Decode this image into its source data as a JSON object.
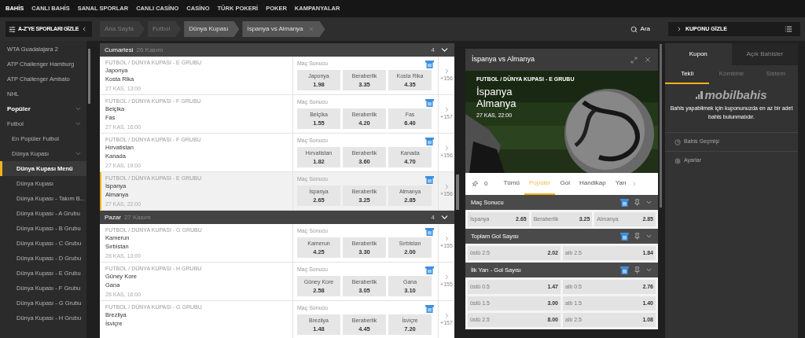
{
  "top_nav": [
    {
      "label": "BAHİS",
      "selected": true
    },
    {
      "label": "CANLI BAHİS",
      "selected": false
    },
    {
      "label": "SANAL SPORLAR",
      "selected": false
    },
    {
      "label": "CANLI CASİNO",
      "selected": false
    },
    {
      "label": "CASİNO",
      "selected": false
    },
    {
      "label": "TÜRK POKERİ",
      "selected": false
    },
    {
      "label": "POKER",
      "selected": false
    },
    {
      "label": "KAMPANYALAR",
      "selected": false
    }
  ],
  "toolbar": {
    "sports_toggle": "A-Z'YE SPORLARI GİZLE",
    "breadcrumbs": [
      {
        "label": "Ana Sayfa",
        "highlighted": false,
        "selected": false
      },
      {
        "label": "Futbol",
        "highlighted": false,
        "selected": false
      },
      {
        "label": "Dünya Kupası",
        "highlighted": true,
        "selected": false
      },
      {
        "label": "İspanya vs Almanya",
        "highlighted": true,
        "selected": true
      }
    ],
    "search": "Ara",
    "coupon_toggle": "KUPONU GİZLE"
  },
  "sidebar": {
    "items": [
      {
        "label": "WTA Guadalajara 2",
        "kind": "link",
        "selected": false
      },
      {
        "label": "ATP Challenger Hamburg",
        "kind": "link",
        "selected": false
      },
      {
        "label": "ATP Challenger Ambato",
        "kind": "link",
        "selected": false
      },
      {
        "label": "NHL",
        "kind": "link",
        "selected": false
      },
      {
        "label": "Popüler",
        "kind": "heading",
        "selected": false,
        "expanded": true,
        "children": [
          {
            "label": "Futbol",
            "kind": "link",
            "selected": false,
            "expanded": true,
            "children": [
              {
                "label": "En Popüler Futbol",
                "kind": "link",
                "selected": false
              },
              {
                "label": "Dünya Kupası",
                "kind": "link",
                "selected": false,
                "expanded": true,
                "children": [
                  {
                    "label": "Dünya Kupası Menü",
                    "kind": "link",
                    "selected": true
                  },
                  {
                    "label": "Dünya Kupası",
                    "kind": "link",
                    "selected": false
                  },
                  {
                    "label": "Dünya Kupası - Takım B...",
                    "kind": "link",
                    "selected": false
                  },
                  {
                    "label": "Dünya Kupası - A Grubu",
                    "kind": "link",
                    "selected": false
                  },
                  {
                    "label": "Dünya Kupası - B Grubu",
                    "kind": "link",
                    "selected": false
                  },
                  {
                    "label": "Dünya Kupası - C Grubu",
                    "kind": "link",
                    "selected": false
                  },
                  {
                    "label": "Dünya Kupası - D Grubu",
                    "kind": "link",
                    "selected": false
                  },
                  {
                    "label": "Dünya Kupası - E Grubu",
                    "kind": "link",
                    "selected": false
                  },
                  {
                    "label": "Dünya Kupası - F Grubu",
                    "kind": "link",
                    "selected": false
                  },
                  {
                    "label": "Dünya Kupası - G Grubu",
                    "kind": "link",
                    "selected": false
                  },
                  {
                    "label": "Dünya Kupası - H Grubu",
                    "kind": "link",
                    "selected": false
                  }
                ]
              }
            ]
          }
        ]
      }
    ]
  },
  "days": [
    {
      "day": "Cumartesi",
      "date": "26 Kasım",
      "count": "4",
      "expanded": true,
      "matches": [
        {
          "league": "FUTBOL / DÜNYA KUPASI - E GRUBU",
          "home": "Japonya",
          "away": "Kosta Rika",
          "time": "27 KAS, 13:00",
          "market": "Maç Sonucu",
          "odds": [
            {
              "label": "Japonya",
              "value": "1.98"
            },
            {
              "label": "Beraberlik",
              "value": "3.35"
            },
            {
              "label": "Kosta Rika",
              "value": "4.35"
            }
          ],
          "more": "+156",
          "selected": false
        },
        {
          "league": "FUTBOL / DÜNYA KUPASI - F GRUBU",
          "home": "Belçika",
          "away": "Fas",
          "time": "27 KAS, 16:00",
          "market": "Maç Sonucu",
          "odds": [
            {
              "label": "Belçika",
              "value": "1.55"
            },
            {
              "label": "Beraberlik",
              "value": "4.20"
            },
            {
              "label": "Fas",
              "value": "6.40"
            }
          ],
          "more": "+157",
          "selected": false
        },
        {
          "league": "FUTBOL / DÜNYA KUPASI - F GRUBU",
          "home": "Hırvatistan",
          "away": "Kanada",
          "time": "27 KAS, 19:00",
          "market": "Maç Sonucu",
          "odds": [
            {
              "label": "Hırvatistan",
              "value": "1.82"
            },
            {
              "label": "Beraberlik",
              "value": "3.60"
            },
            {
              "label": "Kanada",
              "value": "4.70"
            }
          ],
          "more": "+156",
          "selected": false
        },
        {
          "league": "FUTBOL / DÜNYA KUPASI - E GRUBU",
          "home": "İspanya",
          "away": "Almanya",
          "time": "27 KAS, 22:00",
          "market": "Maç Sonucu",
          "odds": [
            {
              "label": "İspanya",
              "value": "2.65"
            },
            {
              "label": "Beraberlik",
              "value": "3.25"
            },
            {
              "label": "Almanya",
              "value": "2.85"
            }
          ],
          "more": "+156",
          "selected": true
        }
      ]
    },
    {
      "day": "Pazar",
      "date": "27 Kasım",
      "count": "4",
      "expanded": true,
      "matches": [
        {
          "league": "FUTBOL / DÜNYA KUPASI - G GRUBU",
          "home": "Kamerun",
          "away": "Sırbistan",
          "time": "28 KAS, 13:00",
          "market": "Maç Sonucu",
          "odds": [
            {
              "label": "Kamerun",
              "value": "4.25"
            },
            {
              "label": "Beraberlik",
              "value": "3.30"
            },
            {
              "label": "Sırbistan",
              "value": "2.00"
            }
          ],
          "more": "+155",
          "selected": false
        },
        {
          "league": "FUTBOL / DÜNYA KUPASI - H GRUBU",
          "home": "Güney Kore",
          "away": "Gana",
          "time": "28 KAS, 16:00",
          "market": "Maç Sonucu",
          "odds": [
            {
              "label": "Güney Kore",
              "value": "2.58"
            },
            {
              "label": "Beraberlik",
              "value": "3.05"
            },
            {
              "label": "Gana",
              "value": "3.10"
            }
          ],
          "more": "+155",
          "selected": false
        },
        {
          "league": "FUTBOL / DÜNYA KUPASI - G GRUBU",
          "home": "Brezilya",
          "away": "İsviçre",
          "market": "Maç Sonucu",
          "odds": [
            {
              "label": "Brezilya",
              "value": "1.48"
            },
            {
              "label": "Beraberlik",
              "value": "4.45"
            },
            {
              "label": "İsviçre",
              "value": "7.20"
            }
          ],
          "more": "+157",
          "selected": false
        }
      ]
    }
  ],
  "detail": {
    "title": "İspanya vs Almanya",
    "league": "FUTBOL / DÜNYA KUPASI - E GRUBU",
    "home": "İspanya",
    "away": "Almanya",
    "time": "27 KAS, 22:00",
    "pinned_count": "0",
    "tabs": [
      {
        "label": "Tümü",
        "selected": false
      },
      {
        "label": "Popüler",
        "selected": true
      },
      {
        "label": "Gol",
        "selected": false
      },
      {
        "label": "Handikap",
        "selected": false
      },
      {
        "label": "Yarı",
        "selected": false
      }
    ],
    "markets": [
      {
        "title": "Maç Sonucu",
        "expanded": true,
        "rows": [
          [
            {
              "label": "İspanya",
              "value": "2.65"
            },
            {
              "label": "Beraberlik",
              "value": "3.25"
            },
            {
              "label": "Almanya",
              "value": "2.85"
            }
          ]
        ]
      },
      {
        "title": "Toplam Gol Sayısı",
        "expanded": true,
        "rows": [
          [
            {
              "label": "üstü 2.5",
              "value": "2.02"
            },
            {
              "label": "altı 2.5",
              "value": "1.84"
            }
          ]
        ]
      },
      {
        "title": "İlk Yarı - Gol Sayısı",
        "expanded": true,
        "rows": [
          [
            {
              "label": "üstü 0.5",
              "value": "1.47"
            },
            {
              "label": "altı 0.5",
              "value": "2.76"
            }
          ],
          [
            {
              "label": "üstü 1.5",
              "value": "3.00"
            },
            {
              "label": "altı 1.5",
              "value": "1.40"
            }
          ],
          [
            {
              "label": "üstü 2.5",
              "value": "8.00"
            },
            {
              "label": "altı 2.5",
              "value": "1.08"
            }
          ]
        ]
      }
    ]
  },
  "coupon": {
    "tabs": [
      {
        "label": "Kupon",
        "selected": true
      },
      {
        "label": "Açık Bahisler",
        "selected": false
      }
    ],
    "subtabs": [
      {
        "label": "Tekli",
        "selected": true
      },
      {
        "label": "Kombine",
        "selected": false
      },
      {
        "label": "Sistem",
        "selected": false
      }
    ],
    "logo": "mobilbahis",
    "message": "Bahis yapabilmek için kuponunuzda en az bir adet bahis bulunmalıdır.",
    "links": [
      "Bahis Geçmişi",
      "Ayarlar"
    ]
  }
}
